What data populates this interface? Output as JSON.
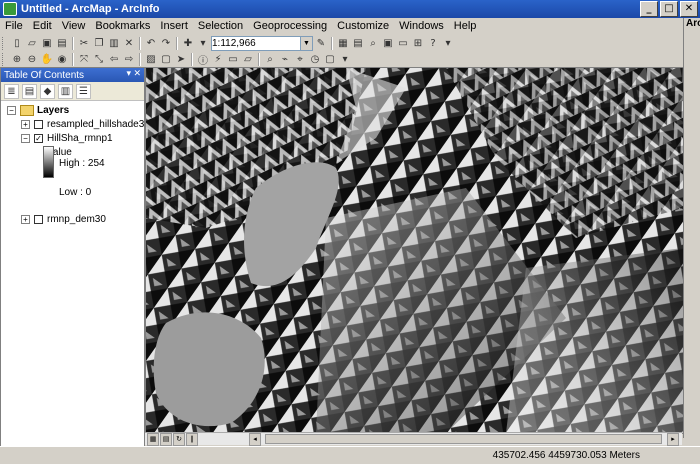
{
  "window": {
    "title": "Untitled - ArcMap - ArcInfo",
    "min": "_",
    "max": "□",
    "close": "✕"
  },
  "menu": [
    "File",
    "Edit",
    "View",
    "Bookmarks",
    "Insert",
    "Selection",
    "Geoprocessing",
    "Customize",
    "Windows",
    "Help"
  ],
  "toolbar": {
    "scale_value": "1:112,966"
  },
  "side_panel": {
    "label": "Arc"
  },
  "toc": {
    "title": "Table Of Contents",
    "root": "Layers",
    "layers": [
      {
        "name": "resampled_hillshade3",
        "checked": false,
        "expanded": false
      },
      {
        "name": "HillSha_rmnp1",
        "checked": true,
        "expanded": true
      },
      {
        "name": "rmnp_dem30",
        "checked": false,
        "expanded": false
      }
    ],
    "legend": {
      "heading": "Value",
      "high": "High : 254",
      "low": "Low : 0"
    }
  },
  "status": {
    "coordinates": "435702.456  4459730.053 Meters"
  },
  "colors": {
    "title": "#1b48a8",
    "map_dark": "#111111",
    "map_light": "#e8e8e8",
    "lake": "#9c9c9c"
  }
}
